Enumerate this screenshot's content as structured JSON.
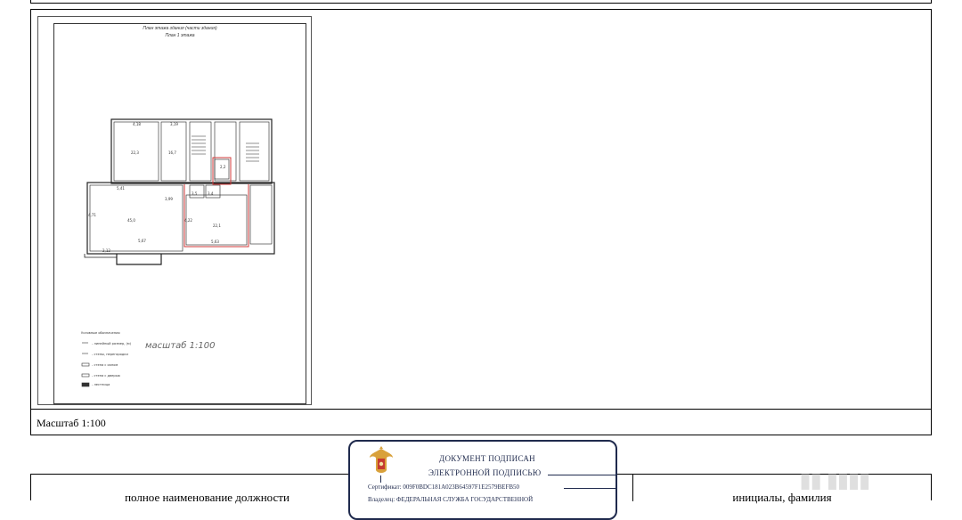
{
  "scale_caption": "Масштаб 1:100",
  "plan": {
    "title_line1": "План этажа здания (части здания)",
    "title_line2": "План 1 этажа",
    "scale_text": "масштаб 1:100",
    "legend_title": "Условные обозначения",
    "legend_items": [
      "- линейный размер, (м)",
      "- стены, перегородки",
      "- стена с окном",
      "- стена с дверью",
      "- лестница"
    ],
    "room_areas": [
      "22,3",
      "16,7",
      "45,0",
      "2,2",
      "22,1",
      "3,5",
      "3,4"
    ],
    "dimensions": [
      "4,18",
      "3,19",
      "5,41",
      "3,99",
      "4,71",
      "5,67",
      "2,12",
      "5,63",
      "4,22"
    ]
  },
  "signature": {
    "left_label": "полное наименование должности",
    "right_label": "инициалы, фамилия"
  },
  "stamp": {
    "line1": "ДОКУМЕНТ ПОДПИСАН",
    "line2": "ЭЛЕКТРОННОЙ ПОДПИСЬЮ",
    "cert": "Сертификат: 009F0BDC181A023B64597F1E2579BEFB50",
    "owner": "Владелец: ФЕДЕРАЛЬНАЯ СЛУЖБА ГОСУДАРСТВЕННОЙ"
  },
  "colors": {
    "stamp_border": "#1f2a4d",
    "plan_red": "#d23a3a"
  }
}
